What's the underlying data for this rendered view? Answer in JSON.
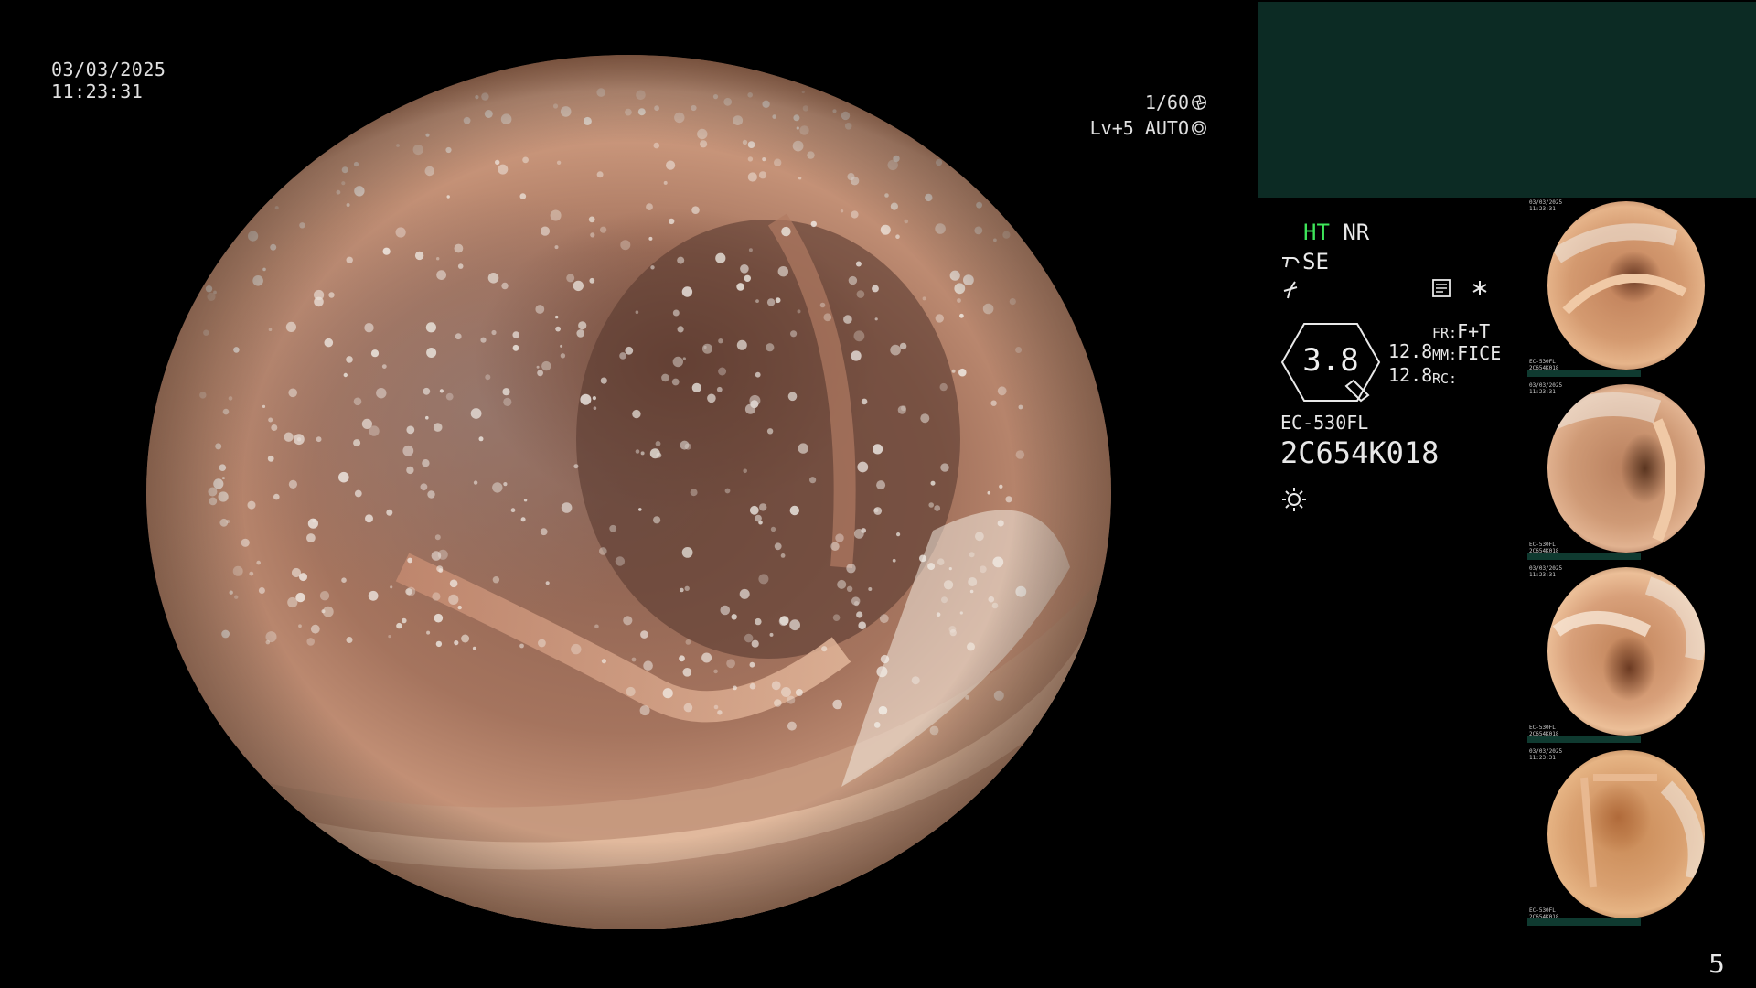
{
  "overlay": {
    "date": "03/03/2025",
    "time": "11:23:31",
    "shutter": "1/60",
    "level": "Lv+5 AUTO"
  },
  "status": {
    "ht_label": "HT",
    "nr_label": "NR",
    "se_label": "SE",
    "gauge_value": "3.8",
    "value_top": "12.8",
    "value_bottom": "12.8",
    "fr_label": "FR:",
    "fr_value": "F+T",
    "mm_label": "MM:",
    "mm_value": "FICE",
    "rc_label": "RC:",
    "scope_model": "EC-530FL",
    "serial": "2C654K018",
    "ht_color": "#3ee65a"
  },
  "thumbnails": [
    {
      "lines": [
        "03/03/2025",
        "11:23:31"
      ],
      "serial_lines": [
        "EC-530FL",
        "2C654K018"
      ]
    },
    {
      "lines": [
        "03/03/2025",
        "11:23:31"
      ],
      "serial_lines": [
        "EC-530FL",
        "2C654K018"
      ]
    },
    {
      "lines": [
        "03/03/2025",
        "11:23:31"
      ],
      "serial_lines": [
        "EC-530FL",
        "2C654K018"
      ]
    },
    {
      "lines": [
        "03/03/2025",
        "11:23:31"
      ],
      "serial_lines": [
        "EC-530FL",
        "2C654K018"
      ]
    }
  ],
  "page_number": "5",
  "colors": {
    "background": "#000000",
    "top_panel": "#0c2b24",
    "thumb_bar": "#0f3a30"
  }
}
